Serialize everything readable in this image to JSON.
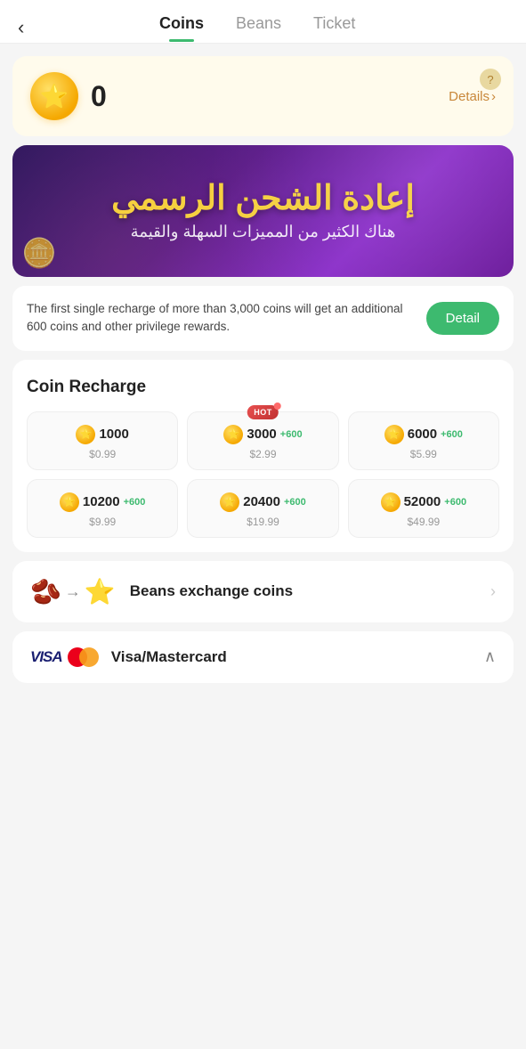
{
  "header": {
    "back_label": "‹",
    "tabs": [
      {
        "id": "coins",
        "label": "Coins",
        "active": true
      },
      {
        "id": "beans",
        "label": "Beans",
        "active": false
      },
      {
        "id": "ticket",
        "label": "Ticket",
        "active": false
      }
    ]
  },
  "balance": {
    "amount": "0",
    "details_label": "Details",
    "details_arrow": "›",
    "help_icon": "?"
  },
  "banner": {
    "title": "إعادة الشحن الرسمي",
    "subtitle": "هناك الكثير من المميزات السهلة والقيمة"
  },
  "promo": {
    "text": "The first single recharge of more than 3,000 coins will get an additional 600 coins and other privilege rewards.",
    "button_label": "Detail"
  },
  "coin_recharge": {
    "title": "Coin Recharge",
    "packages": [
      {
        "id": 1,
        "amount": "1000",
        "bonus": "",
        "price": "$0.99",
        "hot": false
      },
      {
        "id": 2,
        "amount": "3000",
        "bonus": "+600",
        "price": "$2.99",
        "hot": true
      },
      {
        "id": 3,
        "amount": "6000",
        "bonus": "+600",
        "price": "$5.99",
        "hot": false
      },
      {
        "id": 4,
        "amount": "10200",
        "bonus": "+600",
        "price": "$9.99",
        "hot": false
      },
      {
        "id": 5,
        "amount": "20400",
        "bonus": "+600",
        "price": "$19.99",
        "hot": false
      },
      {
        "id": 6,
        "amount": "52000",
        "bonus": "+600",
        "price": "$49.99",
        "hot": false
      }
    ],
    "hot_label": "HOT"
  },
  "exchange": {
    "label": "Beans exchange coins",
    "icon_left": "🫘",
    "icon_arrow": "→",
    "icon_right": "⭐"
  },
  "payment": {
    "label": "Visa/Mastercard"
  },
  "colors": {
    "accent_green": "#3dba6f",
    "coin_gold": "#f5a800",
    "brand_purple": "#5a1a8a"
  }
}
